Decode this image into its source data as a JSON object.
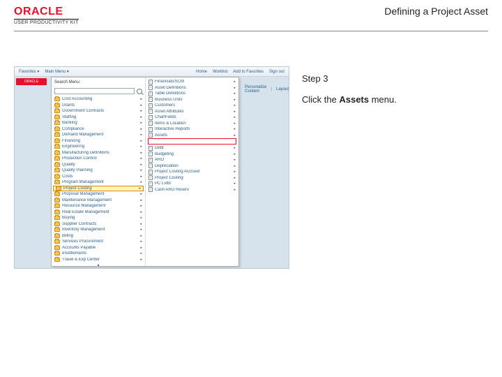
{
  "header": {
    "logo": "ORACLE",
    "logo_subtitle": "USER PRODUCTIVITY KIT",
    "page_title": "Defining a Project Asset"
  },
  "instructions": {
    "step_label": "Step 3",
    "text_before": "Click the ",
    "text_bold": "Assets",
    "text_after": " menu."
  },
  "shot": {
    "topbar": {
      "favorites": "Favorites ▾",
      "main_menu": "Main Menu ▾",
      "home": "Home",
      "worklist": "Worklist",
      "add_fav": "Add to Favorites",
      "signout": "Sign out"
    },
    "mini_logo": "ORACLE",
    "search_label": "Search Menu:",
    "content_area": {
      "link": "Personalize Content",
      "layout": "Layout"
    },
    "left_items": [
      "Cost Accounting",
      "Grants",
      "Government Contracts",
      "Staffing",
      "Banking",
      "Compliance",
      "Demand Management",
      "Financing",
      "Engineering",
      "Manufacturing Definitions",
      "Production Control",
      "Quality",
      "Quality Planning",
      "Costs",
      "Program Management",
      "Project Costing",
      "Proposal Management",
      "Maintenance Management",
      "Resource Management",
      "Real Estate Management",
      "Buying",
      "Supplier Contracts",
      "Inventory Management",
      "Billing",
      "Services Procurement",
      "Accounts Payable",
      "eSettlements",
      "Travel & Exp Center"
    ],
    "right_items": [
      "Financials/SCM",
      "Asset Definitions",
      "Table Definitions",
      "Business Units",
      "Customers",
      "Asset Attributes",
      "ChartFields",
      "Items & Location",
      "Interactive Reports",
      "Assets",
      "Debt",
      "Budgeting",
      "ARO",
      "Depreciation",
      "Project Costing Accrued",
      "Project Costing",
      "PC Lvltd",
      "Cash ARO Reserv"
    ],
    "highlight_index": 15
  }
}
